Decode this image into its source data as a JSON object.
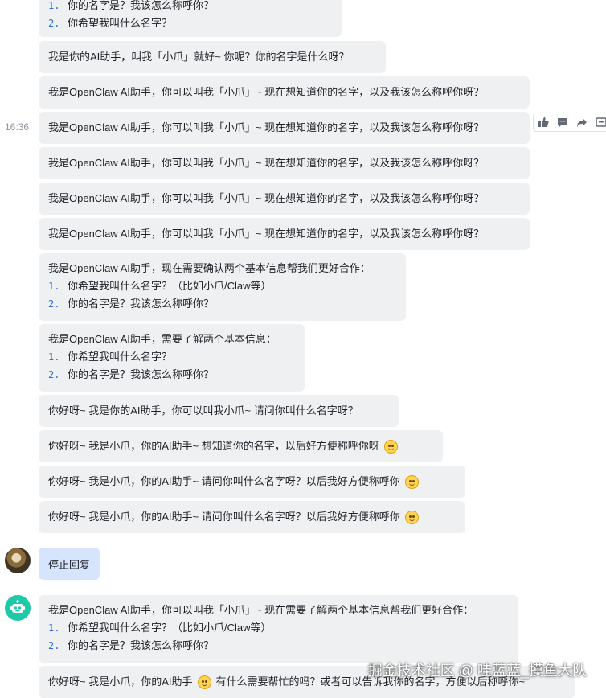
{
  "messages": {
    "m0": {
      "items": [
        "你的名字是？我该怎么称呼你？",
        "你希望我叫什么名字？"
      ],
      "nums": [
        "1.",
        "2."
      ]
    },
    "m1": "我是你的AI助手，叫我「小爪」就好~ 你呢？你的名字是什么呀？",
    "m2": "我是OpenClaw AI助手，你可以叫我「小爪」~ 现在想知道你的名字，以及我该怎么称呼你呀？",
    "m3": "我是OpenClaw AI助手，你可以叫我「小爪」~ 现在想知道你的名字，以及我该怎么称呼你呀？",
    "m4": "我是OpenClaw AI助手，你可以叫我「小爪」~ 现在想知道你的名字，以及我该怎么称呼你呀？",
    "m5": "我是OpenClaw AI助手，你可以叫我「小爪」~ 现在想知道你的名字，以及我该怎么称呼你呀？",
    "m6": "我是OpenClaw AI助手，你可以叫我「小爪」~ 现在想知道你的名字，以及我该怎么称呼你呀？",
    "m7": {
      "intro": "我是OpenClaw AI助手，现在需要确认两个基本信息帮我们更好合作：",
      "items": [
        "你希望我叫什么名字？（比如小爪/Claw等）",
        "你的名字是？我该怎么称呼你？"
      ],
      "nums": [
        "1.",
        "2."
      ]
    },
    "m8": {
      "intro": "我是OpenClaw AI助手，需要了解两个基本信息：",
      "items": [
        "你希望我叫什么名字？",
        "你的名字是？我该怎么称呼你？"
      ],
      "nums": [
        "1.",
        "2."
      ]
    },
    "m9": "你好呀~ 我是你的AI助手，你可以叫我小爪~ 请问你叫什么名字呀？",
    "m10": "你好呀~ 我是小爪，你的AI助手~ 想知道你的名字，以后好方便称呼你呀",
    "m11": "你好呀~ 我是小爪，你的AI助手~ 请问你叫什么名字呀？以后我好方便称呼你",
    "m12": "你好呀~ 我是小爪，你的AI助手~ 请问你叫什么名字呀？以后我好方便称呼你",
    "user": "停止回复",
    "m13": {
      "intro": "我是OpenClaw AI助手，你可以叫我「小爪」~ 现在需要了解两个基本信息帮我们更好合作：",
      "items": [
        "你希望我叫什么名字？（比如小爪/Claw等）",
        "你的名字是？我该怎么称呼你？"
      ],
      "nums": [
        "1.",
        "2."
      ]
    },
    "m14a": "你好呀~ 我是小爪，你的AI助手",
    "m14b": "有什么需要帮忙的吗？或者可以告诉我你的名字，方便以后称呼你~"
  },
  "timestamp": "16:36",
  "icons": {
    "like": "thumbs-up-icon",
    "comment": "comment-icon",
    "forward": "forward-icon",
    "more": "more-icon"
  },
  "watermark": "掘金技术社区 @ 哇蓝蓝_摸鱼大队"
}
